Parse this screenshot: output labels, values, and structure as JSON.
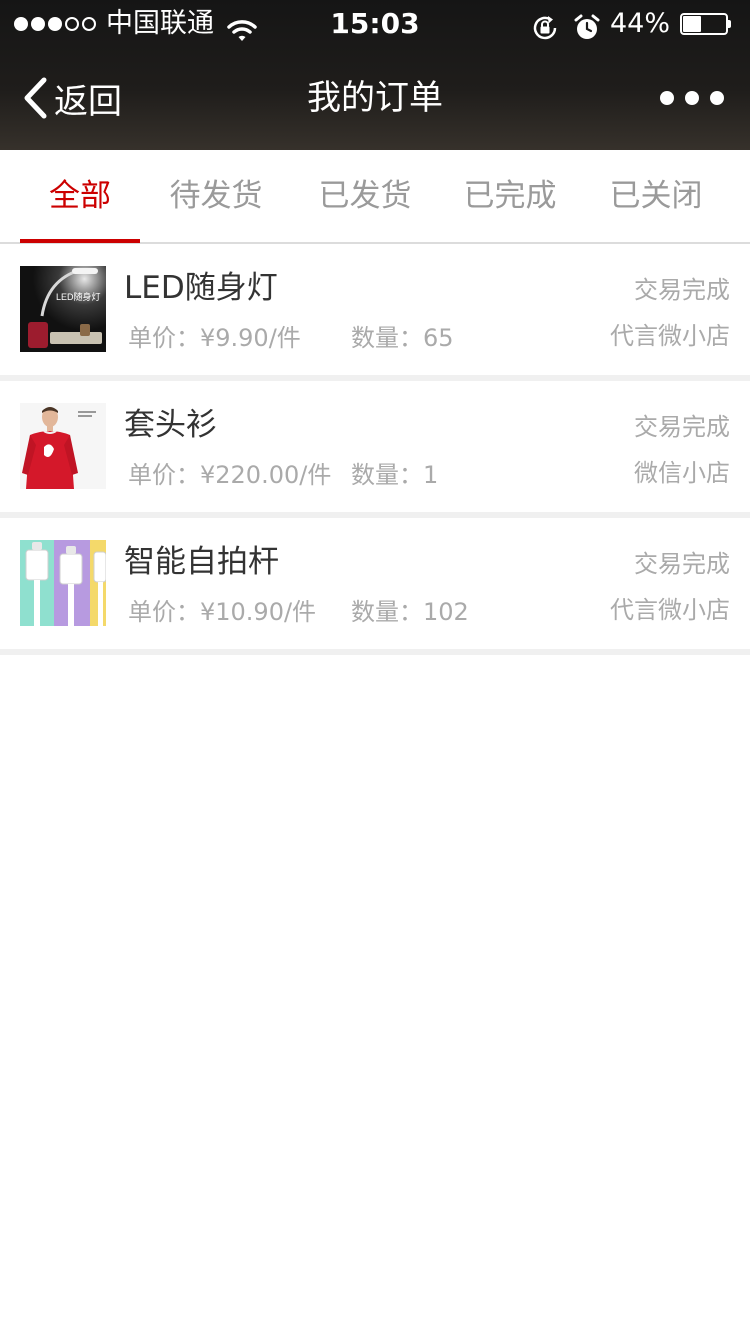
{
  "status_bar": {
    "carrier": "中国联通",
    "time": "15:03",
    "battery_percent_label": "44%",
    "battery_level": 0.44
  },
  "nav": {
    "back_label": "返回",
    "title": "我的订单"
  },
  "tabs": [
    {
      "label": "全部",
      "active": true
    },
    {
      "label": "待发货",
      "active": false
    },
    {
      "label": "已发货",
      "active": false
    },
    {
      "label": "已完成",
      "active": false
    },
    {
      "label": "已关闭",
      "active": false
    }
  ],
  "orders": [
    {
      "name": "LED随身灯",
      "thumb_text": "LED随身灯",
      "price": "单价：¥9.90/件",
      "quantity": "数量：65",
      "status": "交易完成",
      "shop": "代言微小店"
    },
    {
      "name": "套头衫",
      "price": "单价：¥220.00/件",
      "quantity": "数量：1",
      "status": "交易完成",
      "shop": "微信小店"
    },
    {
      "name": "智能自拍杆",
      "price": "单价：¥10.90/件",
      "quantity": "数量：102",
      "status": "交易完成",
      "shop": "代言微小店"
    }
  ],
  "colors": {
    "accent": "#cc0000",
    "header_bg": "#1a1a1a",
    "muted_text": "#aaaaaa"
  },
  "icons": [
    "signal-dots-icon",
    "wifi-icon",
    "rotation-lock-icon",
    "alarm-icon",
    "battery-icon",
    "chevron-left-icon",
    "more-dots-icon"
  ]
}
